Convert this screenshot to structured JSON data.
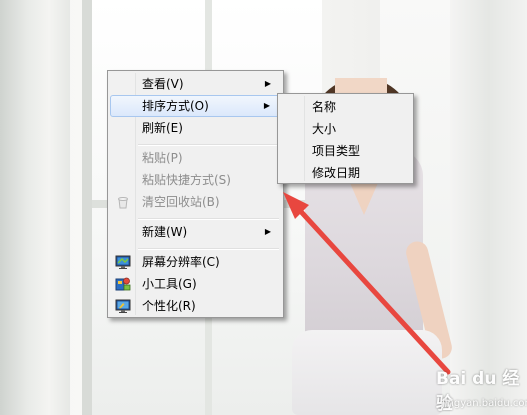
{
  "context_menu": {
    "items": [
      {
        "label": "查看(V)",
        "submenu": true,
        "disabled": false,
        "highlighted": false
      },
      {
        "label": "排序方式(O)",
        "submenu": true,
        "disabled": false,
        "highlighted": true
      },
      {
        "label": "刷新(E)",
        "submenu": false,
        "disabled": false,
        "highlighted": false
      },
      {
        "label": "粘贴(P)",
        "submenu": false,
        "disabled": true,
        "highlighted": false
      },
      {
        "label": "粘贴快捷方式(S)",
        "submenu": false,
        "disabled": true,
        "highlighted": false
      },
      {
        "label": "清空回收站(B)",
        "submenu": false,
        "disabled": true,
        "highlighted": false,
        "icon": "recycle-bin-icon"
      },
      {
        "label": "新建(W)",
        "submenu": true,
        "disabled": false,
        "highlighted": false
      },
      {
        "label": "屏幕分辨率(C)",
        "submenu": false,
        "disabled": false,
        "highlighted": false,
        "icon": "screen-resolution-icon"
      },
      {
        "label": "小工具(G)",
        "submenu": false,
        "disabled": false,
        "highlighted": false,
        "icon": "gadgets-icon"
      },
      {
        "label": "个性化(R)",
        "submenu": false,
        "disabled": false,
        "highlighted": false,
        "icon": "personalize-icon"
      }
    ],
    "submenu_arrow": "▶"
  },
  "sort_submenu": {
    "items": [
      {
        "label": "名称"
      },
      {
        "label": "大小"
      },
      {
        "label": "项目类型"
      },
      {
        "label": "修改日期"
      }
    ]
  },
  "annotation": {
    "arrow_color": "#e8473f"
  },
  "watermark": {
    "logo": "Bai du 经验",
    "url": "jingyan.baidu.com"
  }
}
